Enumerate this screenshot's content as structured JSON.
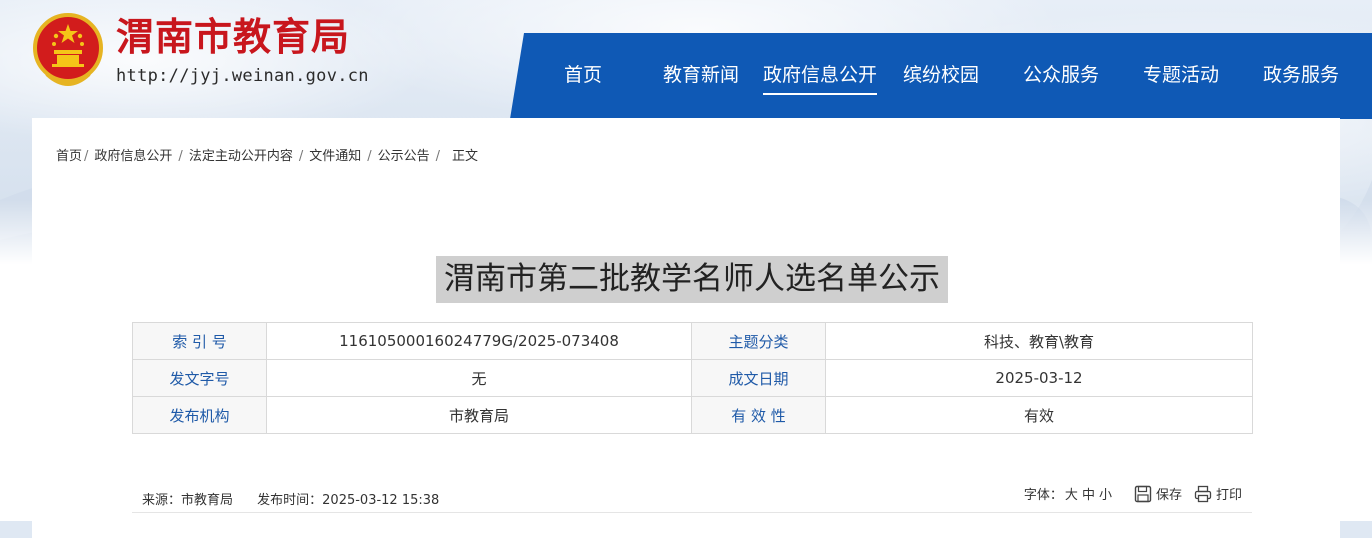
{
  "header": {
    "title": "渭南市教育局",
    "url": "http://jyj.weinan.gov.cn",
    "emblem_icon": "national-emblem-icon"
  },
  "nav": {
    "items": [
      {
        "label": "首页"
      },
      {
        "label": "教育新闻"
      },
      {
        "label": "政府信息公开",
        "active": true
      },
      {
        "label": "缤纷校园"
      },
      {
        "label": "公众服务"
      },
      {
        "label": "专题活动"
      },
      {
        "label": "政务服务"
      }
    ]
  },
  "breadcrumb": {
    "items": [
      "首页",
      "政府信息公开",
      "法定主动公开内容",
      "文件通知",
      "公示公告",
      "正文"
    ]
  },
  "document": {
    "title": "渭南市第二批教学名师人选名单公示",
    "meta": {
      "index_label": "索 引 号",
      "index_value": "11610500016024779G/2025-073408",
      "category_label": "主题分类",
      "category_value": "科技、教育\\教育",
      "doc_no_label": "发文字号",
      "doc_no_value": "无",
      "date_label": "成文日期",
      "date_value": "2025-03-12",
      "agency_label": "发布机构",
      "agency_value": "市教育局",
      "validity_label": "有 效 性",
      "validity_value": "有效"
    },
    "info": {
      "source": "来源：市教育局",
      "publish_time": "发布时间：2025-03-12 15:38",
      "font_size_label": "字体：",
      "size_large": "大",
      "size_medium": "中",
      "size_small": "小",
      "save_label": "保存",
      "print_label": "打印"
    }
  },
  "colors": {
    "brand_red": "#c8161d",
    "nav_blue": "#0f59b5",
    "label_blue": "#1f5aa8"
  }
}
